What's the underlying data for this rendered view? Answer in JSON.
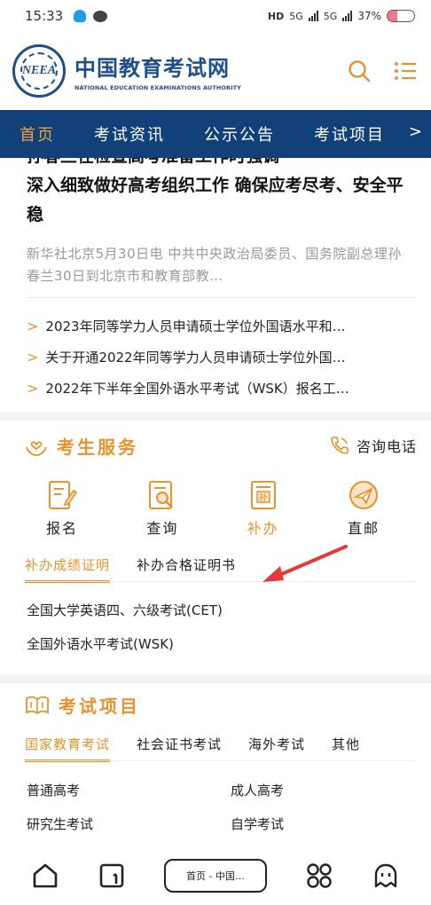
{
  "status_bar": {
    "time": "15:33",
    "network_hd": "HD",
    "network_1": "5G",
    "network_2": "5G",
    "battery": "37%",
    "battery_level": 0.37
  },
  "header": {
    "logo_abbr": "NEEA",
    "logo_cn": "中国教育考试网",
    "logo_en": "NATIONAL EDUCATION EXAMINATIONS AUTHORITY",
    "search_icon": "search-icon",
    "menu_icon": "menu-icon"
  },
  "nav": {
    "items": [
      "首页",
      "考试资讯",
      "公示公告",
      "考试项目"
    ],
    "more": ">"
  },
  "headline": {
    "line_partial": "孙春兰在检查高考准备工作时强调",
    "title": "深入细致做好高考组织工作 确保应考尽考、安全平稳",
    "summary": "新华社北京5月30日电 中共中央政治局委员、国务院副总理孙春兰30日到北京市和教育部教…"
  },
  "news": [
    "2023年同等学力人员申请硕士学位外国语水平和…",
    "关于开通2022年同等学力人员申请硕士学位外国…",
    "2022年下半年全国外语水平考试（WSK）报名工…"
  ],
  "services": {
    "title": "考生服务",
    "consult_label": "咨询电话",
    "items": [
      {
        "label": "报名",
        "icon": "edit-form-icon"
      },
      {
        "label": "查询",
        "icon": "search-doc-icon"
      },
      {
        "label": "补办",
        "icon": "reissue-doc-icon"
      },
      {
        "label": "直邮",
        "icon": "mail-plane-icon"
      }
    ],
    "tabs": [
      "补办成绩证明",
      "补办合格证明书"
    ],
    "list": [
      "全国大学英语四、六级考试(CET)",
      "全国外语水平考试(WSK)"
    ]
  },
  "projects": {
    "title": "考试项目",
    "tabs": [
      "国家教育考试",
      "社会证书考试",
      "海外考试",
      "其他"
    ],
    "items": [
      "普通高考",
      "成人高考",
      "研究生考试",
      "自学考试"
    ]
  },
  "bottom_bar": {
    "address": "首页 - 中国…"
  },
  "colors": {
    "brand_blue": "#12417a",
    "accent_orange": "#e8932d",
    "annotation_red": "#e53935"
  }
}
